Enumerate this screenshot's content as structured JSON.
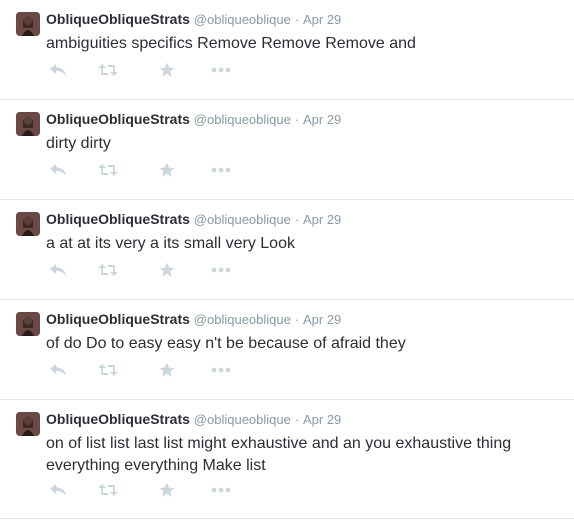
{
  "tweets": [
    {
      "fullname": "ObliqueObliqueStrats",
      "handle": "@obliqueoblique",
      "separator": "·",
      "time": "Apr 29",
      "text": "ambiguities specifics Remove Remove Remove and",
      "icons": [
        "reply-icon",
        "retweet-icon",
        "favorite-icon",
        "more-icon"
      ]
    },
    {
      "fullname": "ObliqueObliqueStrats",
      "handle": "@obliqueoblique",
      "separator": "·",
      "time": "Apr 29",
      "text": "dirty dirty",
      "icons": [
        "reply-icon",
        "retweet-icon",
        "favorite-icon",
        "more-icon"
      ]
    },
    {
      "fullname": "ObliqueObliqueStrats",
      "handle": "@obliqueoblique",
      "separator": "·",
      "time": "Apr 29",
      "text": "a at at its very a its small very Look",
      "icons": [
        "reply-icon",
        "retweet-icon",
        "favorite-icon",
        "more-icon"
      ]
    },
    {
      "fullname": "ObliqueObliqueStrats",
      "handle": "@obliqueoblique",
      "separator": "·",
      "time": "Apr 29",
      "text": "of do Do to easy easy n't be because of afraid they",
      "icons": [
        "reply-icon",
        "retweet-icon",
        "favorite-icon",
        "more-icon"
      ]
    },
    {
      "fullname": "ObliqueObliqueStrats",
      "handle": "@obliqueoblique",
      "separator": "·",
      "time": "Apr 29",
      "text": "on of list list last list might exhaustive and an you exhaustive thing everything everything Make list",
      "icons": [
        "reply-icon",
        "retweet-icon",
        "favorite-icon",
        "more-icon"
      ]
    }
  ],
  "colors": {
    "text": "#292f33",
    "muted": "#8899a6",
    "icon": "#ccd6dd",
    "divider": "#e1e8ed"
  }
}
